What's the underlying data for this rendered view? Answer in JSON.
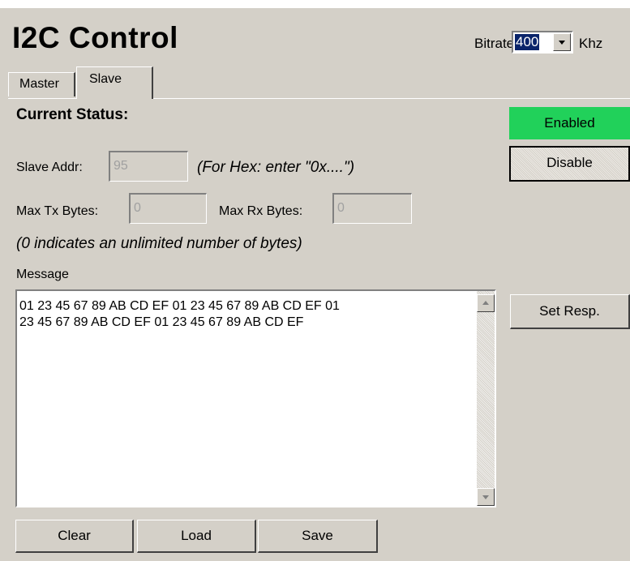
{
  "header": {
    "title": "I2C Control",
    "bitrate_label": "Bitrate",
    "bitrate_value": "400",
    "unit_label": "Khz"
  },
  "tabs": [
    {
      "label": "Master",
      "selected": false
    },
    {
      "label": "Slave",
      "selected": true
    }
  ],
  "status": {
    "label": "Current Status:",
    "state": "Enabled",
    "toggle_label": "Disable",
    "colors": {
      "enabled": "#21d15a"
    }
  },
  "fields": {
    "slave_addr_label": "Slave Addr:",
    "slave_addr_value": "95",
    "hex_hint": "(For Hex: enter \"0x....\")",
    "max_tx_label": "Max Tx Bytes:",
    "max_tx_value": "0",
    "max_rx_label": "Max Rx Bytes:",
    "max_rx_value": "0",
    "unlimited_hint": "(0 indicates an unlimited number of bytes)"
  },
  "message": {
    "label": "Message",
    "line1": "01 23 45 67 89 AB CD EF 01 23 45 67 89 AB CD EF 01",
    "line2": "23 45 67 89 AB CD EF 01 23 45 67 89 AB CD EF"
  },
  "buttons": {
    "set_resp": "Set Resp.",
    "clear": "Clear",
    "load": "Load",
    "save": "Save"
  }
}
